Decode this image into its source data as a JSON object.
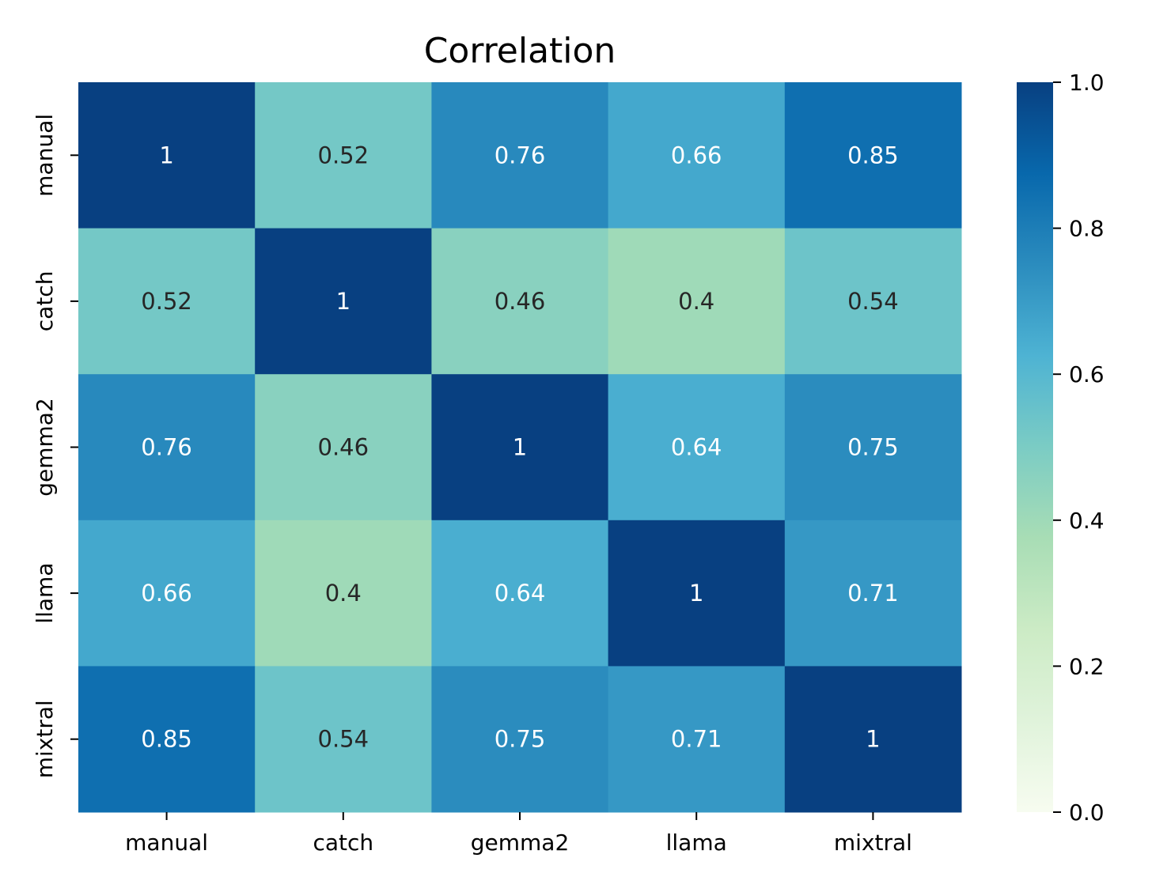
{
  "chart_data": {
    "type": "heatmap",
    "title": "Correlation",
    "xlabel": "",
    "ylabel": "",
    "x_categories": [
      "manual",
      "catch",
      "gemma2",
      "llama",
      "mixtral"
    ],
    "y_categories": [
      "manual",
      "catch",
      "gemma2",
      "llama",
      "mixtral"
    ],
    "values": [
      [
        1,
        0.52,
        0.76,
        0.66,
        0.85
      ],
      [
        0.52,
        1,
        0.46,
        0.4,
        0.54
      ],
      [
        0.76,
        0.46,
        1,
        0.64,
        0.75
      ],
      [
        0.66,
        0.4,
        0.64,
        1,
        0.71
      ],
      [
        0.85,
        0.54,
        0.75,
        0.71,
        1
      ]
    ],
    "value_labels": [
      [
        "1",
        "0.52",
        "0.76",
        "0.66",
        "0.85"
      ],
      [
        "0.52",
        "1",
        "0.46",
        "0.4",
        "0.54"
      ],
      [
        "0.76",
        "0.46",
        "1",
        "0.64",
        "0.75"
      ],
      [
        "0.66",
        "0.4",
        "0.64",
        "1",
        "0.71"
      ],
      [
        "0.85",
        "0.54",
        "0.75",
        "0.71",
        "1"
      ]
    ],
    "colormap": "GnBu",
    "colormap_stops": [
      "#f7fcf0",
      "#e0f3db",
      "#ccebc5",
      "#a8ddb5",
      "#7bccc4",
      "#4eb3d3",
      "#2b8cbe",
      "#0868ac",
      "#084081"
    ],
    "vmin": 0,
    "vmax": 1,
    "colorbar": {
      "ticks": [
        0.0,
        0.2,
        0.4,
        0.6,
        0.8,
        1.0
      ],
      "tick_labels": [
        "0.0",
        "0.2",
        "0.4",
        "0.6",
        "0.8",
        "1.0"
      ],
      "placement": "right"
    },
    "grid": false,
    "annotation_colors": {
      "light": "#ffffff",
      "dark": "#262626"
    }
  }
}
